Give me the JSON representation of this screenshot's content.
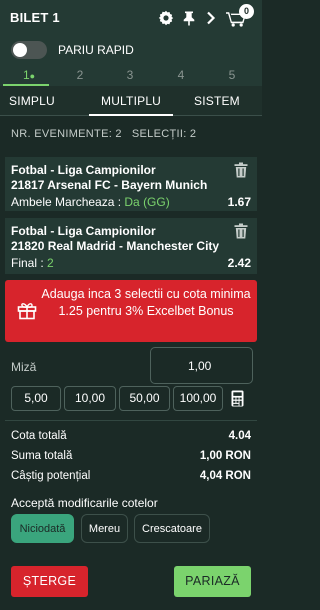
{
  "header": {
    "title": "BILET 1",
    "cart_count": "0"
  },
  "quick_bet": {
    "label": "PARIU RAPID",
    "enabled": false
  },
  "slip_steps": [
    {
      "label": "1",
      "active": true
    },
    {
      "label": "2",
      "active": false
    },
    {
      "label": "3",
      "active": false
    },
    {
      "label": "4",
      "active": false
    },
    {
      "label": "5",
      "active": false
    }
  ],
  "tabs": [
    {
      "label": "SIMPLU",
      "active": false
    },
    {
      "label": "MULTIPLU",
      "active": true
    },
    {
      "label": "SISTEM",
      "active": false
    }
  ],
  "counts": {
    "text": "NR. EVENIMENTE: 2   SELECȚII: 2"
  },
  "bets": [
    {
      "league": "Fotbal - Liga Campionilor",
      "match": "21817  Arsenal FC  -  Bayern Munich",
      "market": "Ambele Marcheaza : ",
      "pick": "Da (GG)",
      "odd": "1.67"
    },
    {
      "league": "Fotbal - Liga Campionilor",
      "match": "21820  Real Madrid  -  Manchester City",
      "market": "Final : ",
      "pick": "2",
      "odd": "2.42"
    }
  ],
  "bonus": {
    "text": "Adauga inca 3 selectii cu cota minima 1.25 pentru 3% Excelbet Bonus",
    "color": "#d7242c"
  },
  "stake": {
    "label": "Miză",
    "value": "1,00"
  },
  "quick_stakes": [
    "5,00",
    "10,00",
    "50,00",
    "100,00"
  ],
  "summary": {
    "total_odds_label": "Cota totală",
    "total_odds_value": "4.04",
    "total_stake_label": "Suma totală",
    "total_stake_value": "1,00 RON",
    "potential_win_label": "Câștig potențial",
    "potential_win_value": "4,04 RON"
  },
  "accept_changes": {
    "title": "Acceptă modificarile cotelor",
    "options": [
      {
        "label": "Niciodată",
        "selected": true
      },
      {
        "label": "Mereu",
        "selected": false
      },
      {
        "label": "Crescatoare",
        "selected": false
      }
    ]
  },
  "actions": {
    "delete_label": "ȘTERGE",
    "place_label": "PARIAZĂ"
  },
  "colors": {
    "background": "#1b2a26",
    "accent_green": "#7bd36d",
    "danger_red": "#d7242c",
    "selected_option": "#3aa57d"
  }
}
